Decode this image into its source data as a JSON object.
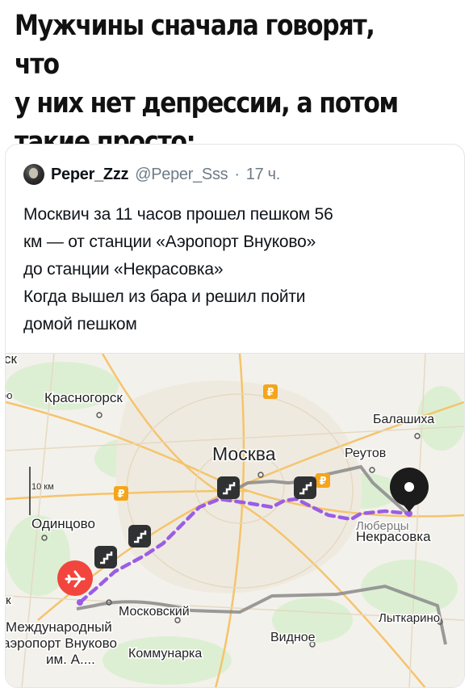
{
  "caption": {
    "line1": "Мужчины сначала говорят, что",
    "line2": "у них нет депрессии, а потом",
    "line3": "такие просто:"
  },
  "tweet": {
    "author_name": "Peper_Zzz",
    "author_handle": "@Peper_Sss",
    "separator": "·",
    "time": "17 ч.",
    "text_line1": "Москвич за 11 часов прошел пешком 56",
    "text_line2": "км — от станции «Аэропорт Внуково»",
    "text_line3": "до станции «Некрасовка»",
    "text_line4": "Когда вышел из бара и решил пойти",
    "text_line5": "домой пешком"
  },
  "map": {
    "label_sk": "ск",
    "label_oo": "оо",
    "label_krasnogorsk": "Красногорск",
    "label_balashikha": "Балашиха",
    "label_moskva": "Москва",
    "label_reutov": "Реутов",
    "label_scale": "10 км",
    "label_odintsovo": "Одинцово",
    "label_lyubertsy": "Люберцы",
    "label_nekrasovka": "Некрасовка",
    "label_k": "к",
    "label_moskovsky": "Московский",
    "label_airport_line1": "Международный",
    "label_airport_line2": "аэропорт Внуково",
    "label_airport_line3": "им. А....",
    "label_kommunarka": "Коммунарка",
    "label_vidnoe": "Видное",
    "label_lytkarino": "Лыткарино",
    "metro_symbol": "₽",
    "colors": {
      "route_walk": "#9b5de5",
      "route_transit": "#8a8a8a",
      "airport_marker": "#f2453d",
      "destination_marker": "#1c1c1c",
      "step_badge": "#2f3133",
      "metro_badge": "#f4a51c",
      "map_bg": "#f3f1ec"
    },
    "icons": {
      "airport_marker": "airplane-icon",
      "destination_marker": "pin-icon",
      "step_badge": "stairs-icon",
      "metro_badge": "metro-icon"
    }
  }
}
